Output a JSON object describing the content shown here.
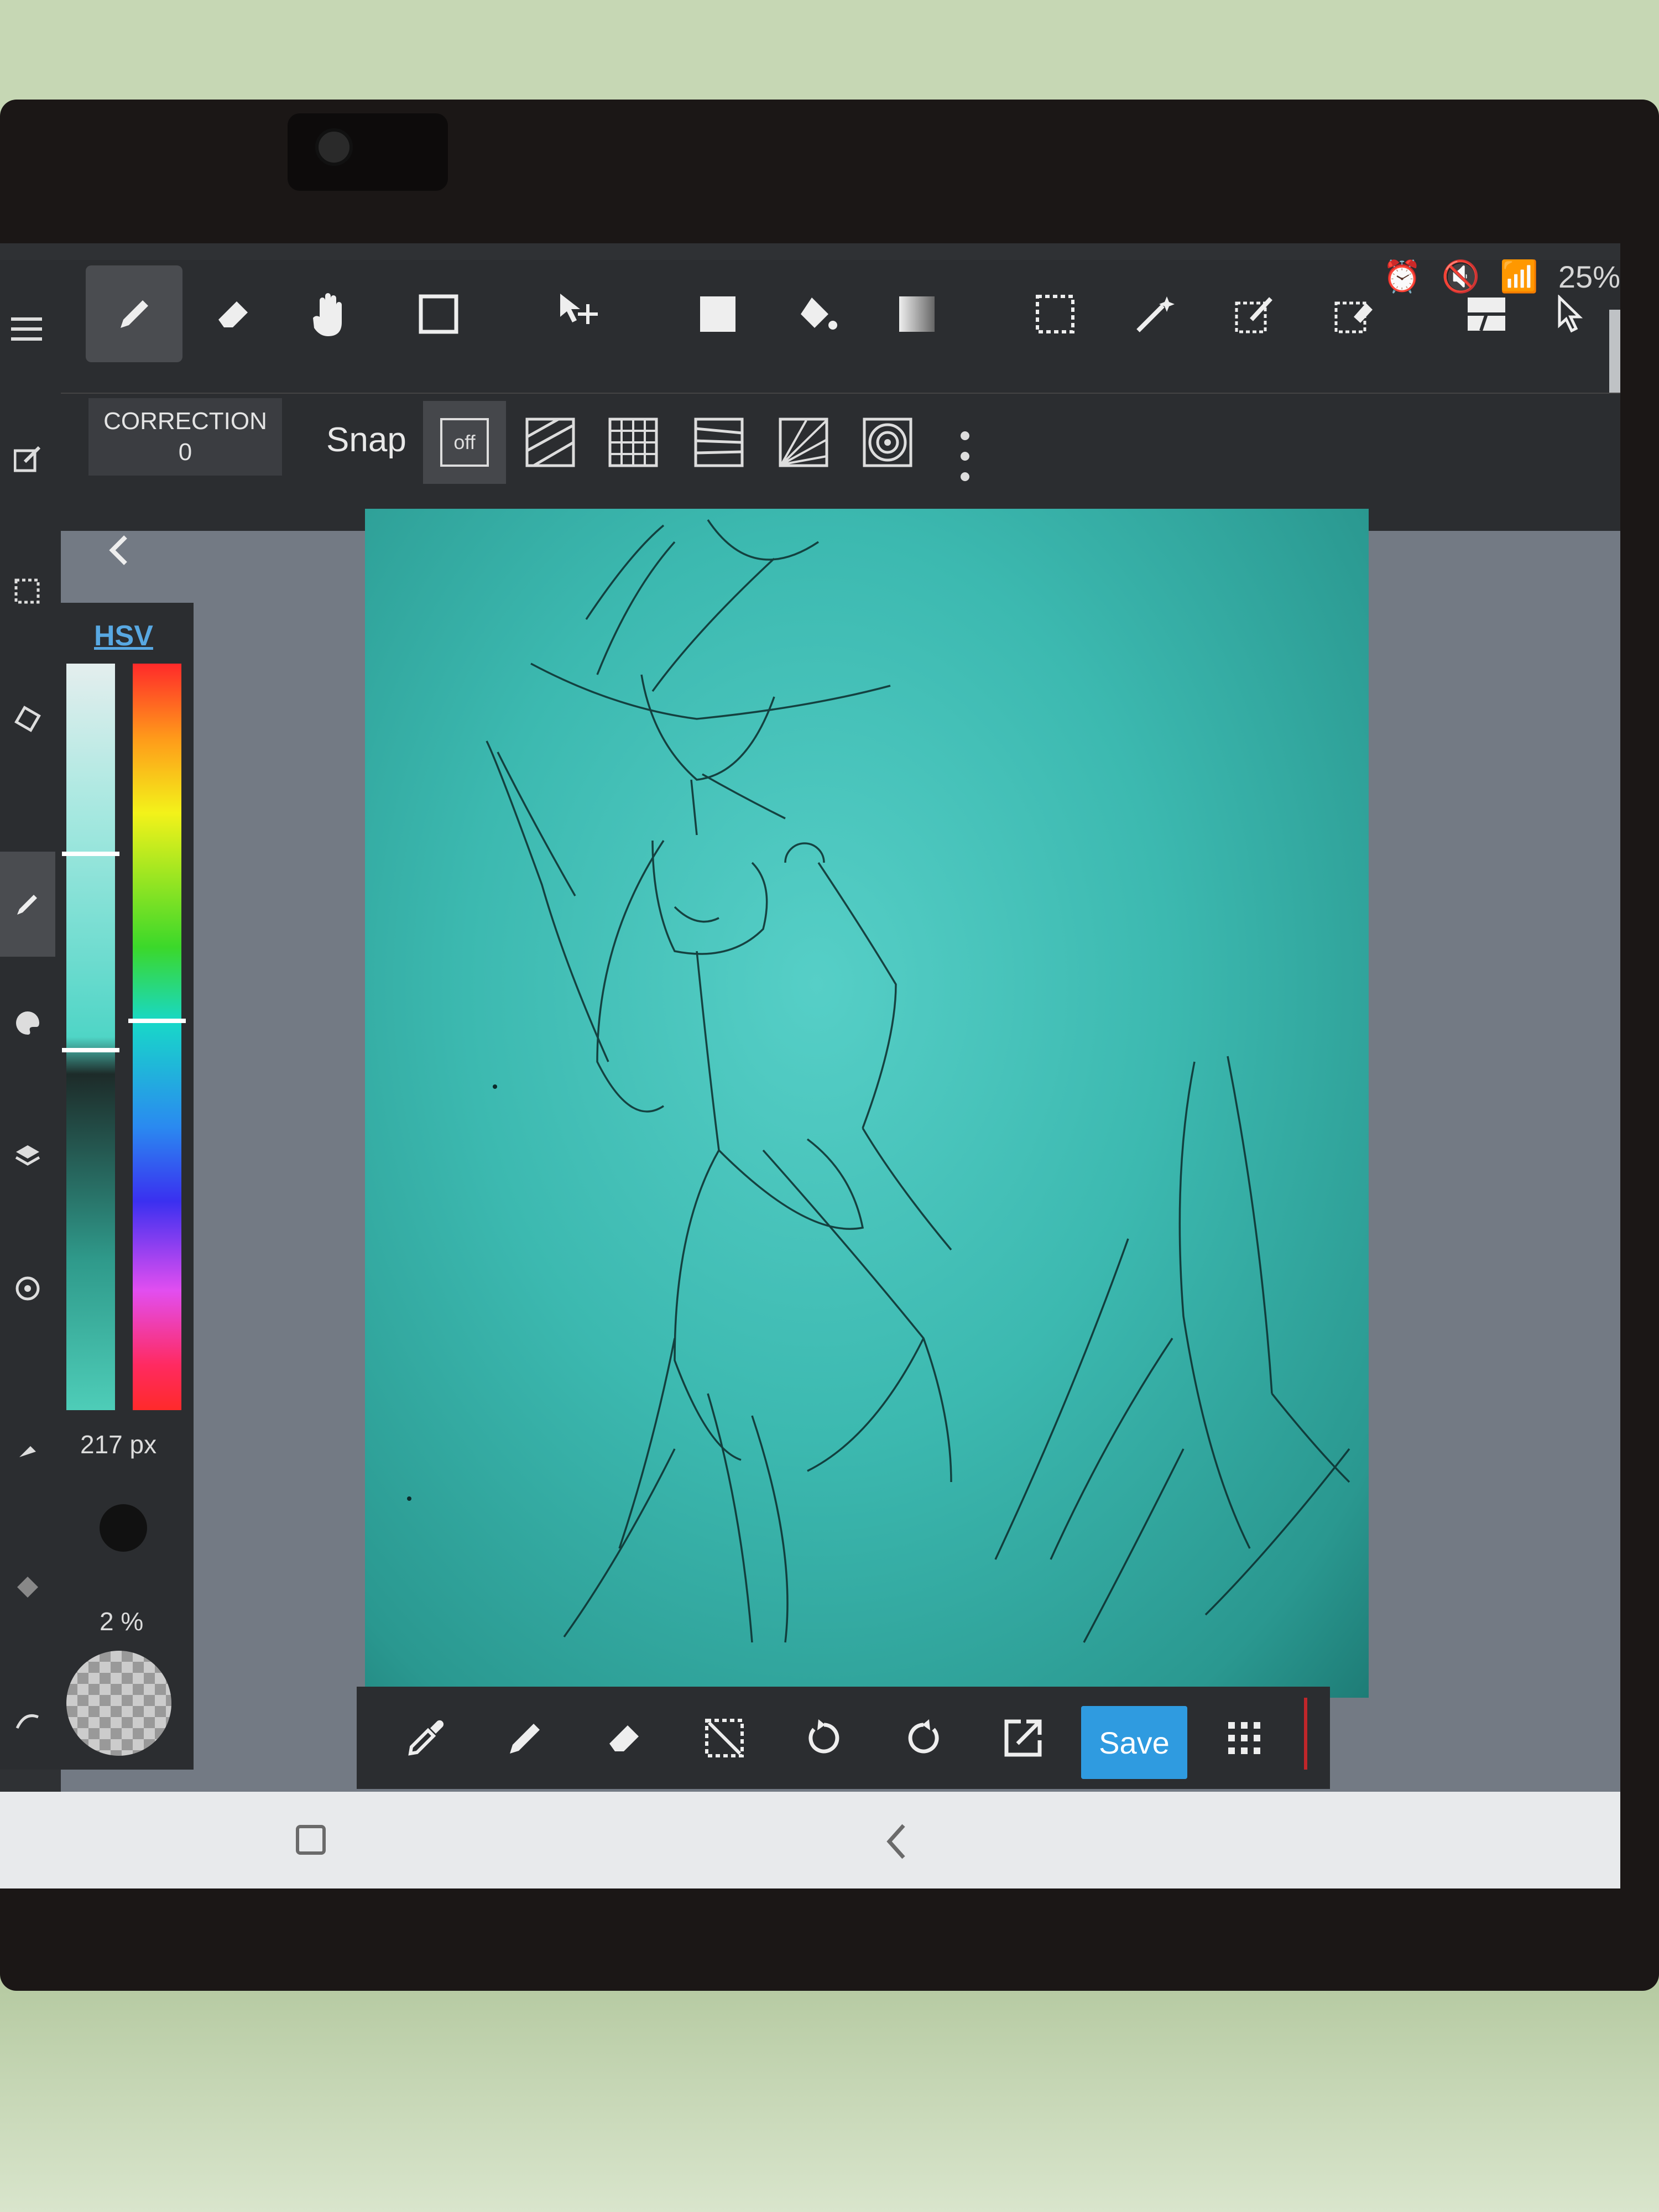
{
  "status": {
    "battery": "25%"
  },
  "toolbar": {
    "correction_title": "CORRECTION",
    "correction_value": "0",
    "snap_label": "Snap",
    "snap_off": "off"
  },
  "color_panel": {
    "mode": "HSV",
    "brush_size": "217 px",
    "opacity": "2 %"
  },
  "bottom_bar": {
    "save_label": "Save"
  },
  "colors": {
    "accent": "#2f9be0",
    "canvas": "#3cb9b0",
    "chrome": "#2b2d30"
  }
}
